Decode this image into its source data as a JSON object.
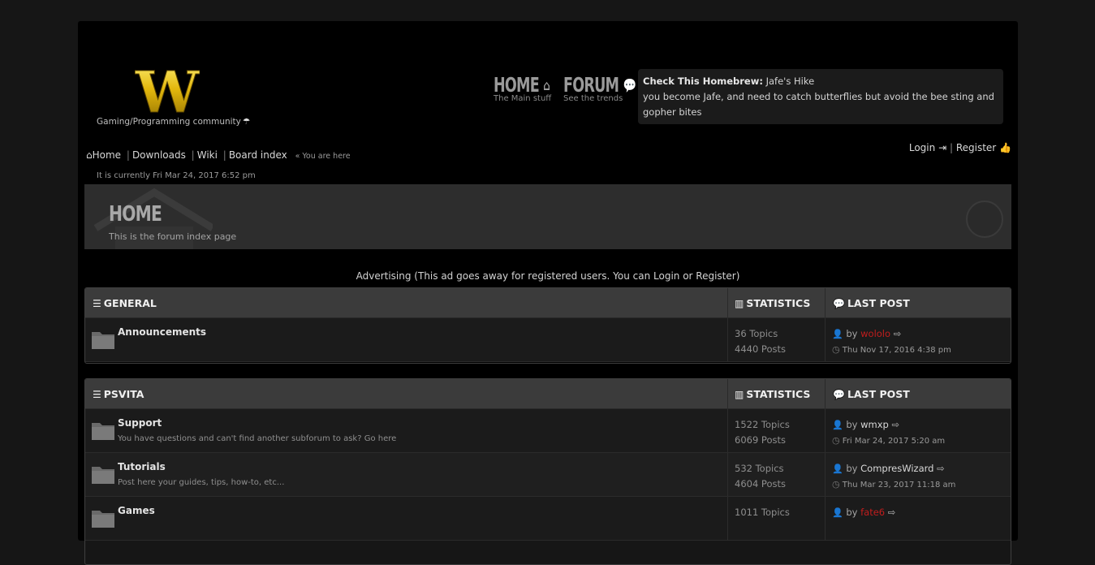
{
  "colors": {
    "page_bg": "#161616",
    "container_bg": "#000000",
    "logo_gold": "#e0b910",
    "header_bar": "#3b3b3b",
    "admin_user": "#c21d1d"
  },
  "logo": {
    "letter": "W",
    "tagline": "Gaming/Programming community",
    "tagline_icon": "umbrella-icon"
  },
  "nav": {
    "home": {
      "label": "HOME",
      "sub": "The Main stuff",
      "icon": "home-icon"
    },
    "forum": {
      "label": "FORUM",
      "sub": "See the trends",
      "icon": "comments-icon"
    }
  },
  "homebrew": {
    "prefix": "Check This Homebrew:",
    "title": "Jafe's Hike",
    "description": "you become Jafe, and need to catch butterflies but avoid the bee sting and gopher bites"
  },
  "account": {
    "login": "Login",
    "register": "Register"
  },
  "breadcrumb": {
    "home": "Home",
    "downloads": "Downloads",
    "wiki": "Wiki",
    "board_index": "Board index",
    "here": "« You are here"
  },
  "current_time": "It is currently Fri Mar 24, 2017 6:52 pm",
  "banner": {
    "title": "HOME",
    "subtitle": "This is the forum index page"
  },
  "advert": "Advertising (This ad goes away for registered users. You can Login or Register)",
  "columns": {
    "statistics": "STATISTICS",
    "last_post": "LAST POST"
  },
  "categories": [
    {
      "name": "GENERAL",
      "forums": [
        {
          "name": "Announcements",
          "desc": "",
          "topics": "36 Topics",
          "posts": "4440 Posts",
          "by": "by",
          "user": "wololo",
          "time": "Thu Nov 17, 2016 4:38 pm"
        }
      ]
    },
    {
      "name": "PSVITA",
      "forums": [
        {
          "name": "Support",
          "desc": "You have questions and can't find another subforum to ask? Go here",
          "topics": "1522 Topics",
          "posts": "6069 Posts",
          "by": "by",
          "user": "wmxp",
          "time": "Fri Mar 24, 2017 5:20 am"
        },
        {
          "name": "Tutorials",
          "desc": "Post here your guides, tips, how-to, etc...",
          "topics": "532 Topics",
          "posts": "4604 Posts",
          "by": "by",
          "user": "CompresWizard",
          "time": "Thu Mar 23, 2017 11:18 am"
        },
        {
          "name": "Games",
          "desc": "",
          "topics": "1011 Topics",
          "posts": "",
          "by": "by",
          "user": "fate6",
          "time": ""
        }
      ]
    }
  ]
}
